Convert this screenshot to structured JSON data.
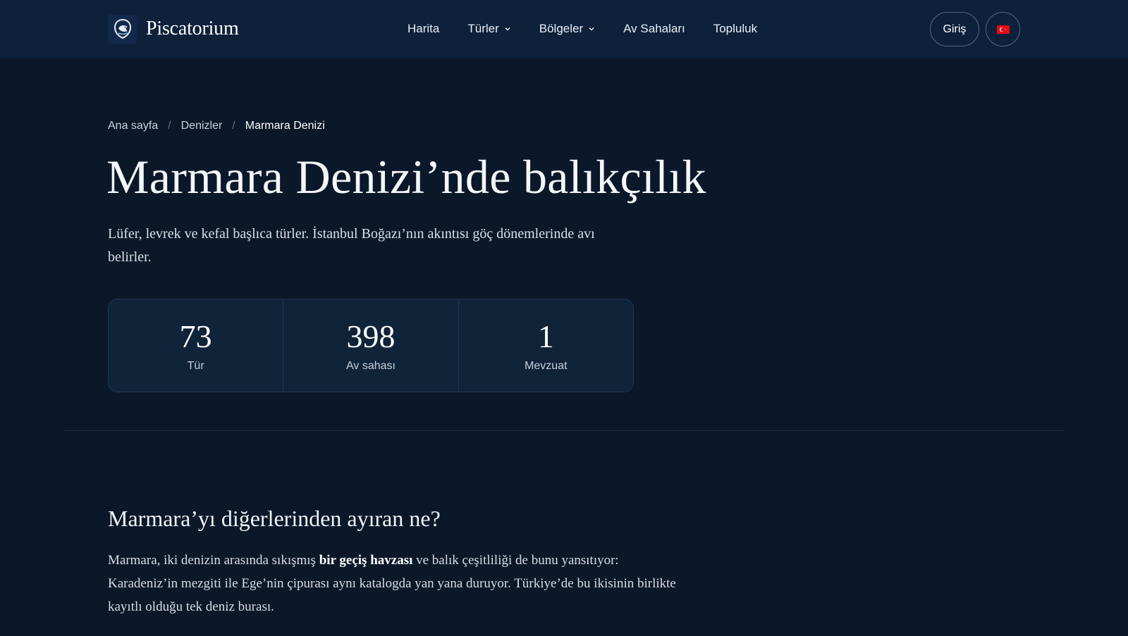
{
  "header": {
    "brand": "Piscatorium",
    "nav": [
      {
        "label": "Harita",
        "dropdown": false
      },
      {
        "label": "Türler",
        "dropdown": true
      },
      {
        "label": "Bölgeler",
        "dropdown": true
      },
      {
        "label": "Av Sahaları",
        "dropdown": false
      },
      {
        "label": "Topluluk",
        "dropdown": false
      }
    ],
    "login_label": "Giriş",
    "language_icon": "turkey-flag-icon"
  },
  "breadcrumb": {
    "items": [
      "Ana sayfa",
      "Denizler"
    ],
    "current": "Marmara Denizi",
    "separator": "/"
  },
  "page": {
    "title": "Marmara Denizi’nde balıkçılık",
    "lead": "Lüfer, levrek ve kefal başlıca türler. İstanbul Boğazı’nın akıntısı göç dönemlerinde avı belirler."
  },
  "stats": [
    {
      "value": "73",
      "label": "Tür"
    },
    {
      "value": "398",
      "label": "Av sahası"
    },
    {
      "value": "1",
      "label": "Mevzuat"
    }
  ],
  "section": {
    "title": "Marmara’yı diğerlerinden ayıran ne?",
    "text_before": "Marmara, iki denizin arasında sıkışmış ",
    "text_bold": "bir geçiş havzası",
    "text_after": " ve balık çeşitliliği de bunu yansıtıyor: Karadeniz’in mezgiti ile Ege’nin çipurası aynı katalogda yan yana duruyor. Türkiye’de bu ikisinin birlikte kayıtlı olduğu tek deniz burası."
  },
  "colors": {
    "background": "#0b1829",
    "header": "#0e213a",
    "card": "#0f2339",
    "flag_red": "#e30a17"
  }
}
